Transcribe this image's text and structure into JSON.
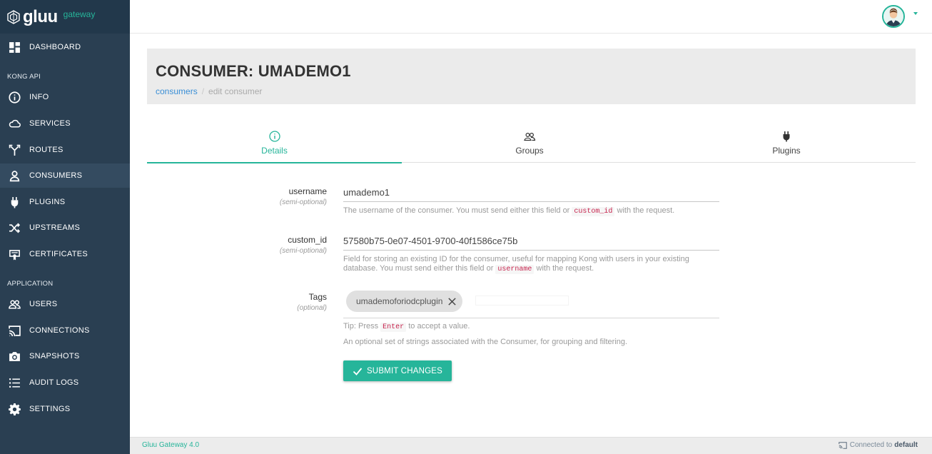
{
  "brand": {
    "name": "gluu",
    "subtitle": "gateway"
  },
  "sidebar": {
    "items": [
      {
        "label": "DASHBOARD",
        "icon": "dashboard-icon"
      },
      {
        "label": "INFO",
        "icon": "info-icon"
      },
      {
        "label": "SERVICES",
        "icon": "cloud-icon"
      },
      {
        "label": "ROUTES",
        "icon": "routes-icon"
      },
      {
        "label": "CONSUMERS",
        "icon": "user-icon",
        "active": true
      },
      {
        "label": "PLUGINS",
        "icon": "plug-icon"
      },
      {
        "label": "UPSTREAMS",
        "icon": "shuffle-icon"
      },
      {
        "label": "CERTIFICATES",
        "icon": "certificate-icon"
      },
      {
        "label": "USERS",
        "icon": "users-icon"
      },
      {
        "label": "CONNECTIONS",
        "icon": "cast-icon"
      },
      {
        "label": "SNAPSHOTS",
        "icon": "camera-icon"
      },
      {
        "label": "AUDIT LOGS",
        "icon": "list-icon"
      },
      {
        "label": "SETTINGS",
        "icon": "gear-icon"
      }
    ],
    "sections": {
      "kong_api": "KONG API",
      "application": "APPLICATION"
    }
  },
  "header": {
    "title": "CONSUMER: UMADEMO1",
    "breadcrumb": {
      "link": "consumers",
      "separator": "/",
      "current": "edit consumer"
    }
  },
  "tabs": [
    {
      "label": "Details",
      "icon": "info-icon",
      "active": true
    },
    {
      "label": "Groups",
      "icon": "users-icon"
    },
    {
      "label": "Plugins",
      "icon": "plug-icon"
    }
  ],
  "form": {
    "username": {
      "label": "username",
      "hint": "(semi-optional)",
      "value": "umademo1",
      "help_before": "The username of the consumer. You must send either this field or",
      "help_code": "custom_id",
      "help_after": "with the request."
    },
    "custom_id": {
      "label": "custom_id",
      "hint": "(semi-optional)",
      "value": "57580b75-0e07-4501-9700-40f1586ce75b",
      "help_before": "Field for storing an existing ID for the consumer, useful for mapping Kong with users in your existing database. You must send either this field or",
      "help_code": "username",
      "help_after": "with the request."
    },
    "tags": {
      "label": "Tags",
      "hint": "(optional)",
      "chips": [
        "umademoforiodcplugin"
      ],
      "tip_before": "Tip: Press",
      "tip_code": "Enter",
      "tip_after": "to accept a value.",
      "help": "An optional set of strings associated with the Consumer, for grouping and filtering."
    },
    "submit_label": "SUBMIT CHANGES"
  },
  "footer": {
    "version": "Gluu Gateway 4.0",
    "status_prefix": "Connected to",
    "connection": "default"
  },
  "colors": {
    "accent": "#26b59a",
    "sidebar": "#2a3f52",
    "link": "#3a8fd6",
    "code": "#c7254e"
  }
}
